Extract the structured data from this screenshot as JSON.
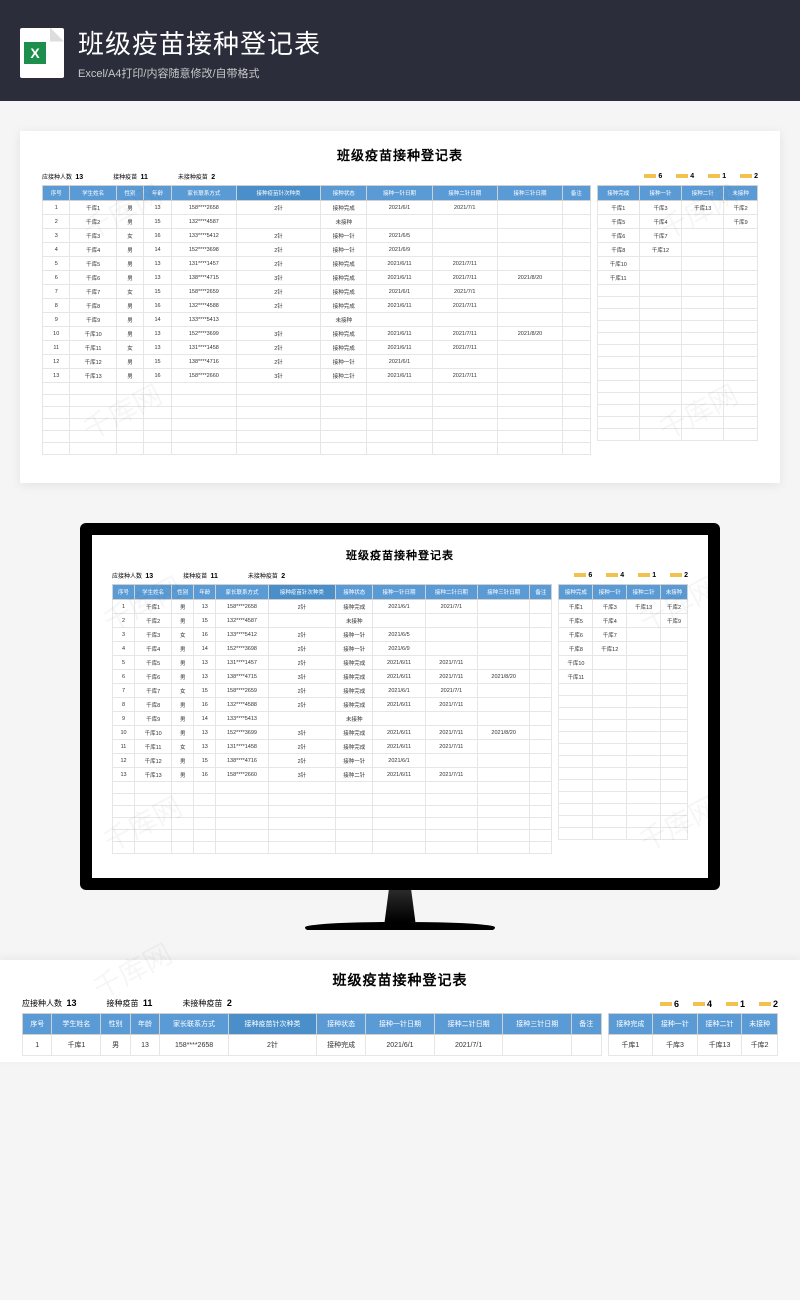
{
  "header": {
    "title": "班级疫苗接种登记表",
    "subtitle": "Excel/A4打印/内容随意修改/自带格式",
    "icon_letter": "X"
  },
  "sheet": {
    "title": "班级疫苗接种登记表",
    "summary": {
      "should_label": "应接种人数",
      "should_value": "13",
      "done_label": "接种疫苗",
      "done_value": "11",
      "not_label": "未接种疫苗",
      "not_value": "2",
      "stats": [
        "6",
        "4",
        "1",
        "2"
      ]
    },
    "main_headers": [
      "序号",
      "学生姓名",
      "性别",
      "年龄",
      "家长联系方式",
      "接种疫苗针次种类",
      "接种状态",
      "接种一针日期",
      "接种二针日期",
      "接种三针日期",
      "备注"
    ],
    "rows": [
      {
        "no": "1",
        "name": "千库1",
        "sex": "男",
        "age": "13",
        "phone": "158****2658",
        "type": "2针",
        "status": "接种完成",
        "d1": "2021/6/1",
        "d2": "2021/7/1",
        "d3": "",
        "note": ""
      },
      {
        "no": "2",
        "name": "千库2",
        "sex": "男",
        "age": "15",
        "phone": "132****4587",
        "type": "",
        "status": "未接种",
        "d1": "",
        "d2": "",
        "d3": "",
        "note": ""
      },
      {
        "no": "3",
        "name": "千库3",
        "sex": "女",
        "age": "16",
        "phone": "133****5412",
        "type": "2针",
        "status": "接种一针",
        "d1": "2021/6/5",
        "d2": "",
        "d3": "",
        "note": ""
      },
      {
        "no": "4",
        "name": "千库4",
        "sex": "男",
        "age": "14",
        "phone": "152****3698",
        "type": "2针",
        "status": "接种一针",
        "d1": "2021/6/9",
        "d2": "",
        "d3": "",
        "note": ""
      },
      {
        "no": "5",
        "name": "千库5",
        "sex": "男",
        "age": "13",
        "phone": "131****1457",
        "type": "2针",
        "status": "接种完成",
        "d1": "2021/6/11",
        "d2": "2021/7/11",
        "d3": "",
        "note": ""
      },
      {
        "no": "6",
        "name": "千库6",
        "sex": "男",
        "age": "13",
        "phone": "138****4715",
        "type": "3针",
        "status": "接种完成",
        "d1": "2021/6/11",
        "d2": "2021/7/11",
        "d3": "2021/8/20",
        "note": ""
      },
      {
        "no": "7",
        "name": "千库7",
        "sex": "女",
        "age": "15",
        "phone": "158****2659",
        "type": "2针",
        "status": "接种完成",
        "d1": "2021/6/1",
        "d2": "2021/7/1",
        "d3": "",
        "note": ""
      },
      {
        "no": "8",
        "name": "千库8",
        "sex": "男",
        "age": "16",
        "phone": "132****4588",
        "type": "2针",
        "status": "接种完成",
        "d1": "2021/6/11",
        "d2": "2021/7/11",
        "d3": "",
        "note": ""
      },
      {
        "no": "9",
        "name": "千库9",
        "sex": "男",
        "age": "14",
        "phone": "133****5413",
        "type": "",
        "status": "未接种",
        "d1": "",
        "d2": "",
        "d3": "",
        "note": ""
      },
      {
        "no": "10",
        "name": "千库10",
        "sex": "男",
        "age": "13",
        "phone": "152****3699",
        "type": "3针",
        "status": "接种完成",
        "d1": "2021/6/11",
        "d2": "2021/7/11",
        "d3": "2021/8/20",
        "note": ""
      },
      {
        "no": "11",
        "name": "千库11",
        "sex": "女",
        "age": "13",
        "phone": "131****1458",
        "type": "2针",
        "status": "接种完成",
        "d1": "2021/6/11",
        "d2": "2021/7/11",
        "d3": "",
        "note": ""
      },
      {
        "no": "12",
        "name": "千库12",
        "sex": "男",
        "age": "15",
        "phone": "138****4716",
        "type": "2针",
        "status": "接种一针",
        "d1": "2021/6/1",
        "d2": "",
        "d3": "",
        "note": ""
      },
      {
        "no": "13",
        "name": "千库13",
        "sex": "男",
        "age": "16",
        "phone": "158****2660",
        "type": "3针",
        "status": "接种二针",
        "d1": "2021/6/11",
        "d2": "2021/7/11",
        "d3": "",
        "note": ""
      }
    ],
    "side_headers": [
      "接种完成",
      "接种一针",
      "接种二针",
      "未接种"
    ],
    "side_rows": [
      [
        "千库1",
        "千库3",
        "千库13",
        "千库2"
      ],
      [
        "千库5",
        "千库4",
        "",
        "千库9"
      ],
      [
        "千库6",
        "千库7",
        "",
        ""
      ],
      [
        "千库8",
        "千库12",
        "",
        ""
      ],
      [
        "千库10",
        "",
        "",
        ""
      ],
      [
        "千库11",
        "",
        "",
        ""
      ]
    ]
  },
  "watermark": "千库网"
}
